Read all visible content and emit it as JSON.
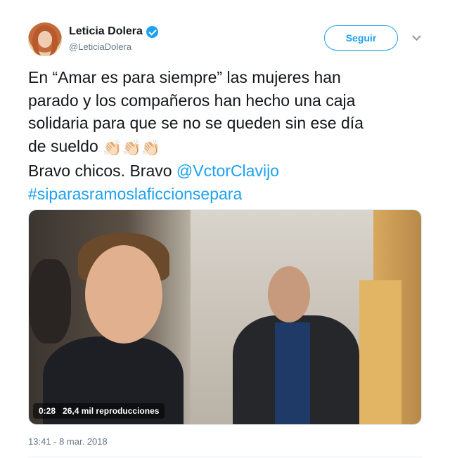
{
  "author": {
    "name": "Leticia Dolera",
    "handle": "@LeticiaDolera",
    "verified": true
  },
  "follow_button_label": "Seguir",
  "tweet": {
    "lines": [
      "En “Amar es para siempre” las mujeres han",
      "parado y los compañeros han hecho una caja",
      "solidaria para que se no se queden sin ese día",
      "de sueldo"
    ],
    "clap_emoji": "👏🏻👏🏻👏🏻",
    "bravo_text": "Bravo chicos. Bravo ",
    "mention": "@VctorClavijo",
    "hashtag": "#siparasramoslaficcionsepara"
  },
  "video": {
    "duration": "0:28",
    "views": "26,4 mil reproducciones"
  },
  "timestamp": "13:41 - 8 mar. 2018",
  "colors": {
    "accent": "#1da1f2",
    "text": "#14171a",
    "secondary": "#657786"
  },
  "icons": {
    "verified": "verified-badge-icon",
    "more": "chevron-down-icon"
  }
}
